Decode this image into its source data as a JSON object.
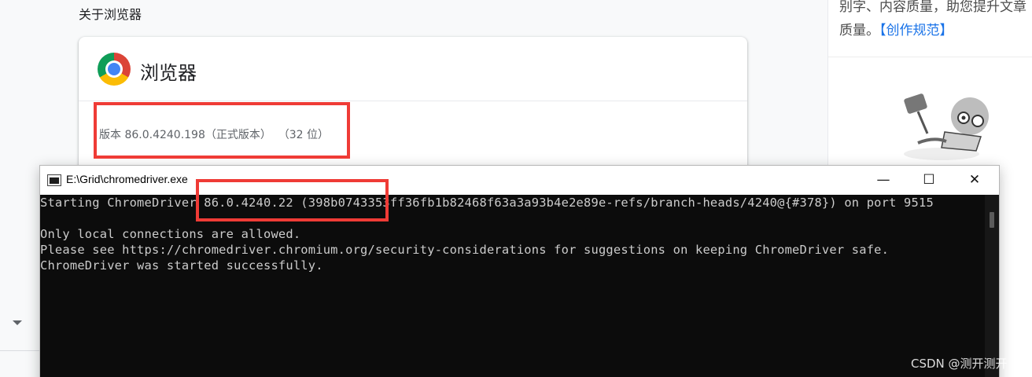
{
  "about_page": {
    "title": "关于浏览器",
    "browser_name": "浏览器",
    "version_text": "版本 86.0.4240.198（正式版本）  （32 位）"
  },
  "sidebar": {
    "text_before_link": "别字、内容质量，助您提升文章质量。",
    "link_text": "【创作规范】"
  },
  "console": {
    "window_title": "E:\\Grid\\chromedriver.exe",
    "controls": {
      "minimize": "—",
      "maximize": "☐",
      "close": "✕"
    },
    "lines": [
      "Starting ChromeDriver 86.0.4240.22 (398b0743353ff36fb1b82468f63a3a93b4e2e89e-refs/branch-heads/4240@{#378}) on port 9515",
      "",
      "Only local connections are allowed.",
      "Please see https://chromedriver.chromium.org/security-considerations for suggestions on keeping ChromeDriver safe.",
      "ChromeDriver was started successfully."
    ]
  },
  "watermark": "CSDN @测开测开",
  "colors": {
    "highlight": "#ef3b36",
    "console_bg": "#0c0c0c",
    "console_text": "#cccccc",
    "link": "#1a73e8"
  },
  "icons": {
    "browser_logo": "chrome-logo-icon",
    "console_app": "cmd-icon",
    "dropdown": "caret-down-icon"
  }
}
